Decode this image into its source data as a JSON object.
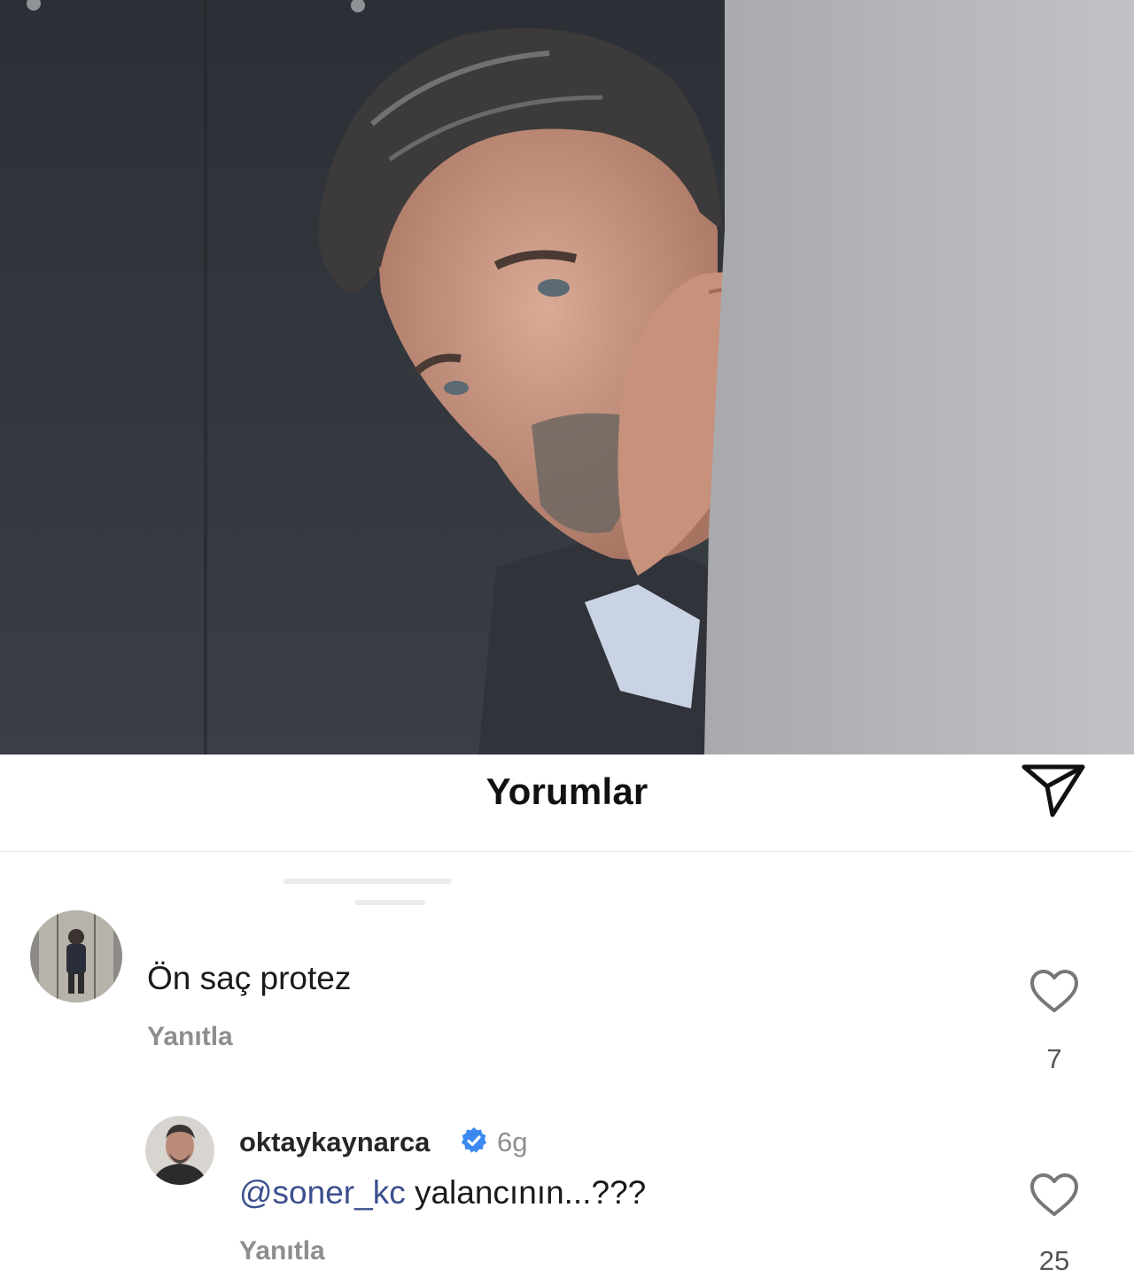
{
  "post": {
    "image_icon": "portrait-photo"
  },
  "comments_header": {
    "title": "Yorumlar",
    "share_icon": "paper-plane-icon"
  },
  "comments": [
    {
      "text": "Ön saç protez",
      "reply_label": "Yanıtla",
      "like_count": "7"
    },
    {
      "username": "oktaykaynarca",
      "verified": true,
      "time": "6g",
      "mention": "@soner_kc",
      "text": " yalancının...???",
      "reply_label": "Yanıtla",
      "like_count": "25"
    }
  ],
  "colors": {
    "mention": "#3d4f8e",
    "muted": "#8e8e8e",
    "verified": "#3b88f0"
  }
}
